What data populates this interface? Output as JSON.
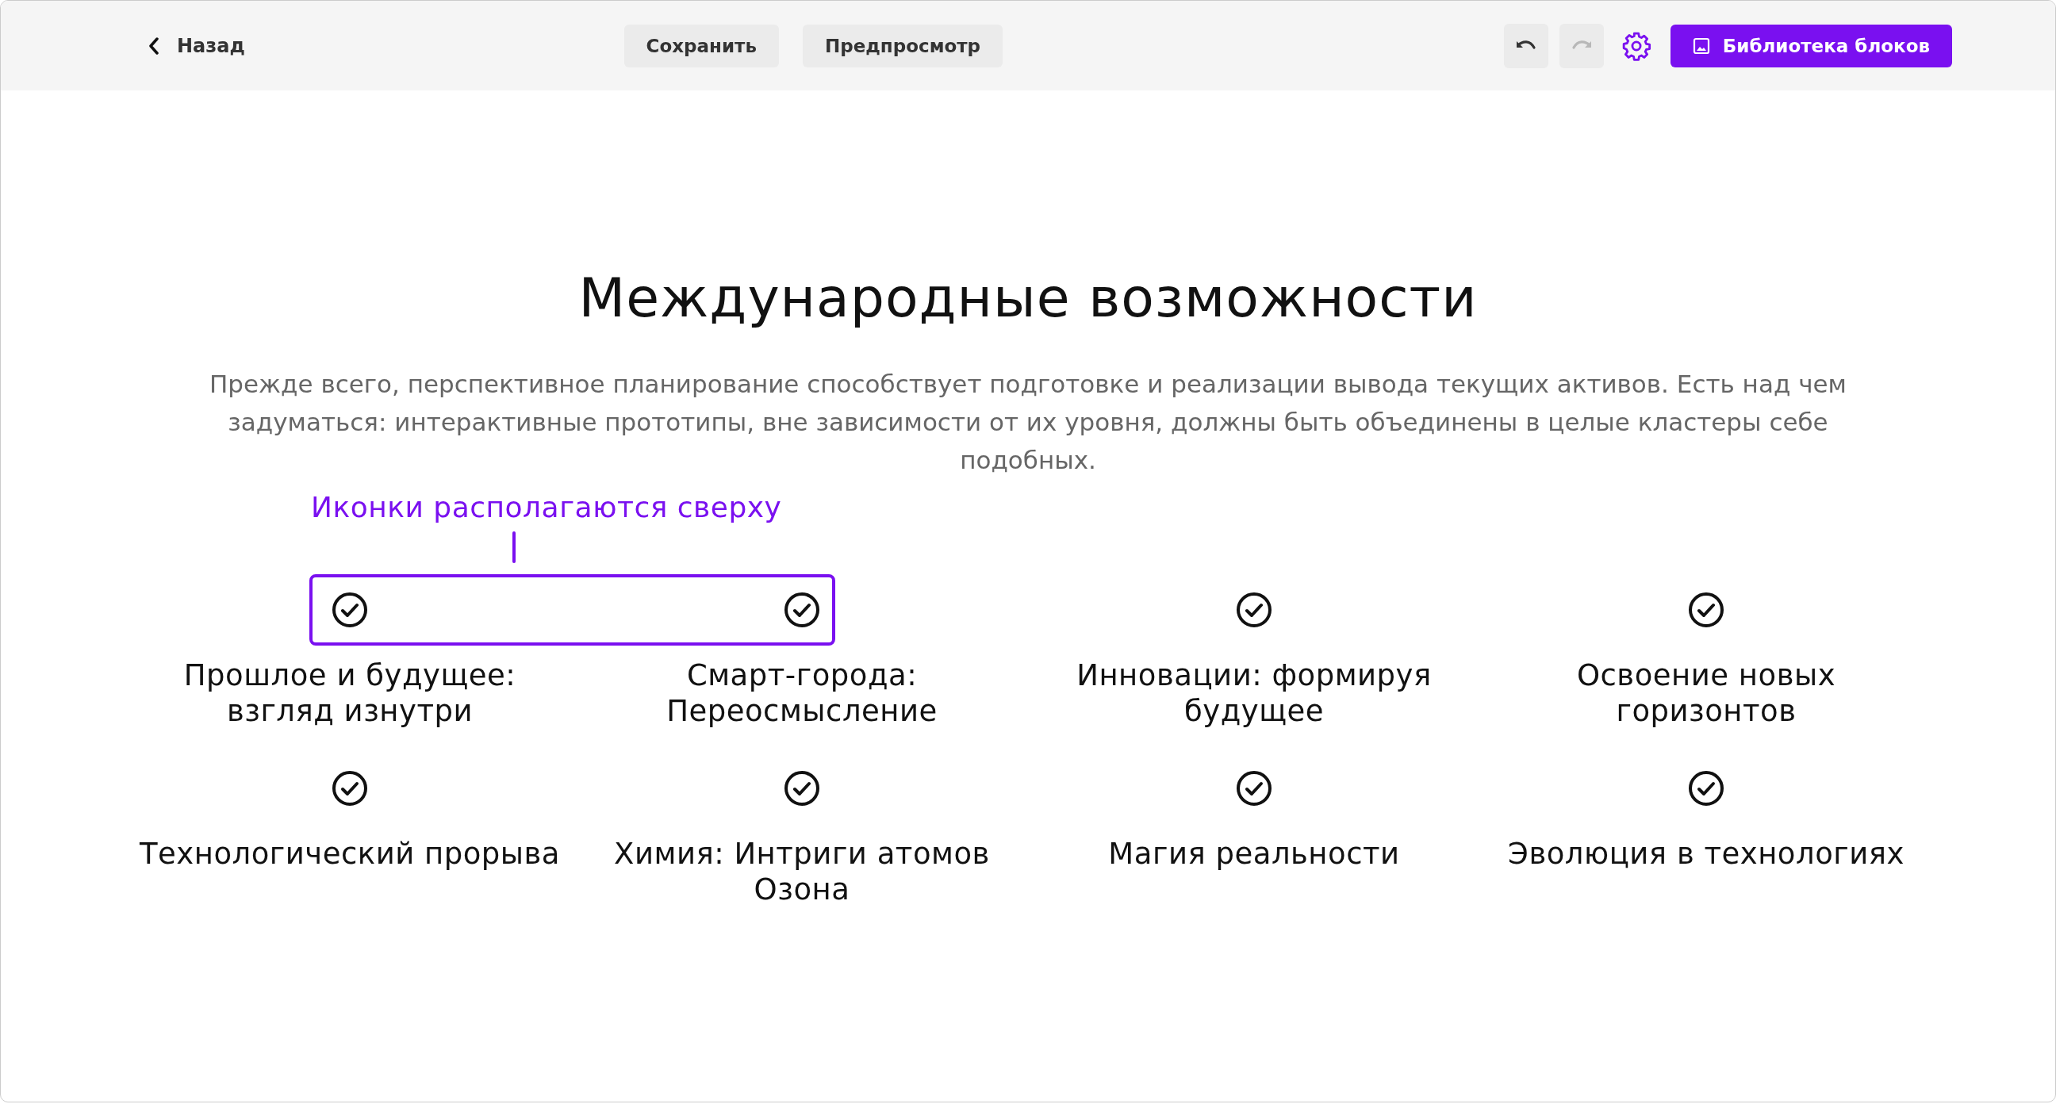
{
  "toolbar": {
    "back": "Назад",
    "buttons": [
      "Сохранить",
      "Предпросмотр"
    ],
    "undo": {
      "disabled": false
    },
    "redo": {
      "disabled": true
    },
    "library": "Библиотека блоков"
  },
  "heading": "Международные возможности",
  "description": "Прежде всего, перспективное планирование способствует подготовке и реализации вывода текущих активов. Есть над чем задуматься: интерактивные прототипы, вне зависимости от их уровня, должны быть объединены в целые кластеры себе подобных.",
  "annotation": "Иконки располагаются сверху",
  "features": [
    {
      "title": "Прошлое и будущее: взгляд изнутри"
    },
    {
      "title": "Смарт-города: Переосмысление"
    },
    {
      "title": "Инновации: формируя будущее"
    },
    {
      "title": "Освоение новых горизонтов"
    },
    {
      "title": "Технологический прорыва"
    },
    {
      "title": "Химия: Интриги атомов Озона"
    },
    {
      "title": "Магия реальности"
    },
    {
      "title": "Эволюция в технологиях"
    }
  ]
}
